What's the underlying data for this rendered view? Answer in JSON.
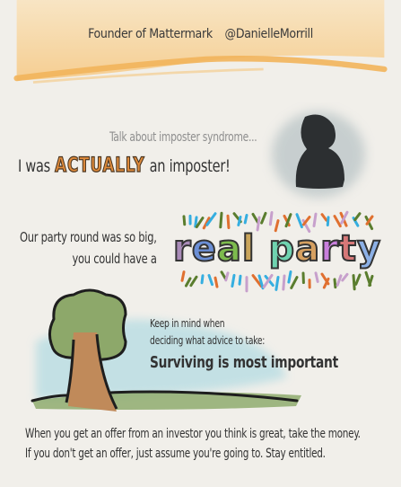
{
  "header": {
    "role": "Founder of Mattermark",
    "handle": "@DanielleMorrill"
  },
  "imposter": {
    "intro": "Talk about imposter syndrome...",
    "line_before": "I was",
    "emphasis": "ACTUALLY",
    "line_after": "an imposter!"
  },
  "party": {
    "line1": "Our party round was so big,",
    "line2": "you could have a",
    "letters": [
      {
        "ch": "r",
        "color": "#a98bb8"
      },
      {
        "ch": "e",
        "color": "#6b8fd6"
      },
      {
        "ch": "a",
        "color": "#7dbb4d"
      },
      {
        "ch": "l",
        "color": "#c9a45a"
      },
      {
        "ch": " ",
        "color": "#000000"
      },
      {
        "ch": "p",
        "color": "#6fd3b0"
      },
      {
        "ch": "a",
        "color": "#d6a060"
      },
      {
        "ch": "r",
        "color": "#c97fdc"
      },
      {
        "ch": "t",
        "color": "#d77878"
      },
      {
        "ch": "y",
        "color": "#8cb0e6"
      }
    ],
    "confetti_colors": [
      "#5a7d2e",
      "#e07030",
      "#c7a0cc",
      "#35aee0"
    ]
  },
  "advice": {
    "line1": "Keep in mind when",
    "line2": "deciding what advice to take:",
    "headline": "Surviving is most important"
  },
  "bottom": {
    "line1": "When you get an offer from an investor you think is great, take the money.",
    "line2": "If you don't get an offer, just assume you're going to. Stay entitled."
  }
}
